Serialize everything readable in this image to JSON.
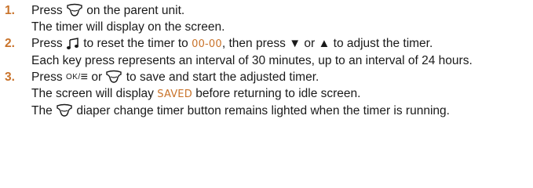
{
  "steps": [
    {
      "number": "1.",
      "line1": {
        "pre": "Press",
        "icon": "diaper-timer-icon",
        "post": "on the parent unit."
      },
      "line2": "The timer will display on the screen."
    },
    {
      "number": "2.",
      "line1": {
        "pre": "Press",
        "icon": "music-note-icon",
        "mid1": "to reset the timer to",
        "value": "00-00",
        "mid2": ", then press",
        "down": "▼",
        "or": "or",
        "up": "▲",
        "post": "to adjust the timer."
      },
      "line2": "Each key press represents an interval of 30 minutes, up to an interval of 24 hours."
    },
    {
      "number": "3.",
      "line1": {
        "pre": "Press",
        "ok_key": "OK/",
        "menu_glyph": "≡",
        "or": "or",
        "icon": "diaper-timer-icon",
        "post": "to save and start the adjusted timer."
      },
      "line2": {
        "pre": "The screen will display",
        "value": "SAVED",
        "post": "before returning to idle screen."
      },
      "line3": {
        "pre": "The",
        "icon": "diaper-timer-icon",
        "post": "diaper change timer button remains lighted when the timer is running."
      }
    }
  ],
  "colors": {
    "accent": "#c9732b",
    "text": "#1a1a1a"
  }
}
